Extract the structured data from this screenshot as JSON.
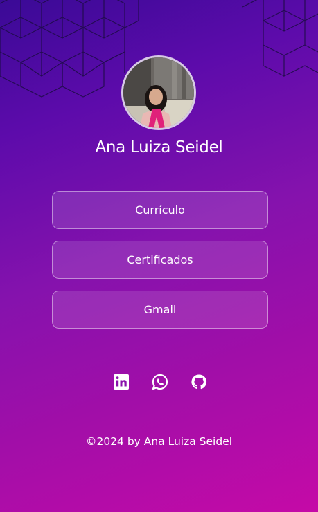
{
  "profile": {
    "name": "Ana Luiza Seidel",
    "avatar": "profile-photo"
  },
  "links": [
    {
      "label": "Currículo"
    },
    {
      "label": "Certificados"
    },
    {
      "label": "Gmail"
    }
  ],
  "social_icons": [
    "linkedin-icon",
    "whatsapp-icon",
    "github-icon"
  ],
  "footer": {
    "text": "©2024 by Ana Luiza Seidel"
  },
  "colors": {
    "gradient_top": "#3a0a96",
    "gradient_bottom": "#c50aa7",
    "button_border": "rgba(255,255,255,0.45)",
    "text": "#ffffff"
  }
}
